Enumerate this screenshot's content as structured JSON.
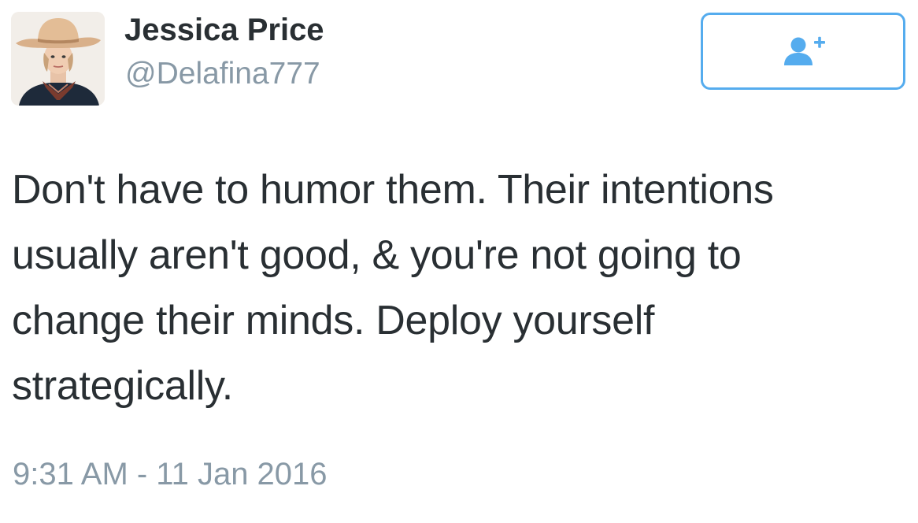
{
  "user": {
    "display_name": "Jessica Price",
    "handle": "@Delafina777",
    "avatar_icon": "profile-photo"
  },
  "follow_button": {
    "icon": "follow-user-plus-icon",
    "color": "#55acee"
  },
  "tweet": {
    "lines": [
      "Don't have to humor them. Their intentions",
      "usually aren't good, & you're not going to",
      "change their minds. Deploy yourself",
      "strategically."
    ],
    "timestamp": "9:31 AM - 11 Jan 2016"
  },
  "colors": {
    "text": "#292f33",
    "secondary_text": "#8899a6",
    "accent": "#55acee"
  }
}
